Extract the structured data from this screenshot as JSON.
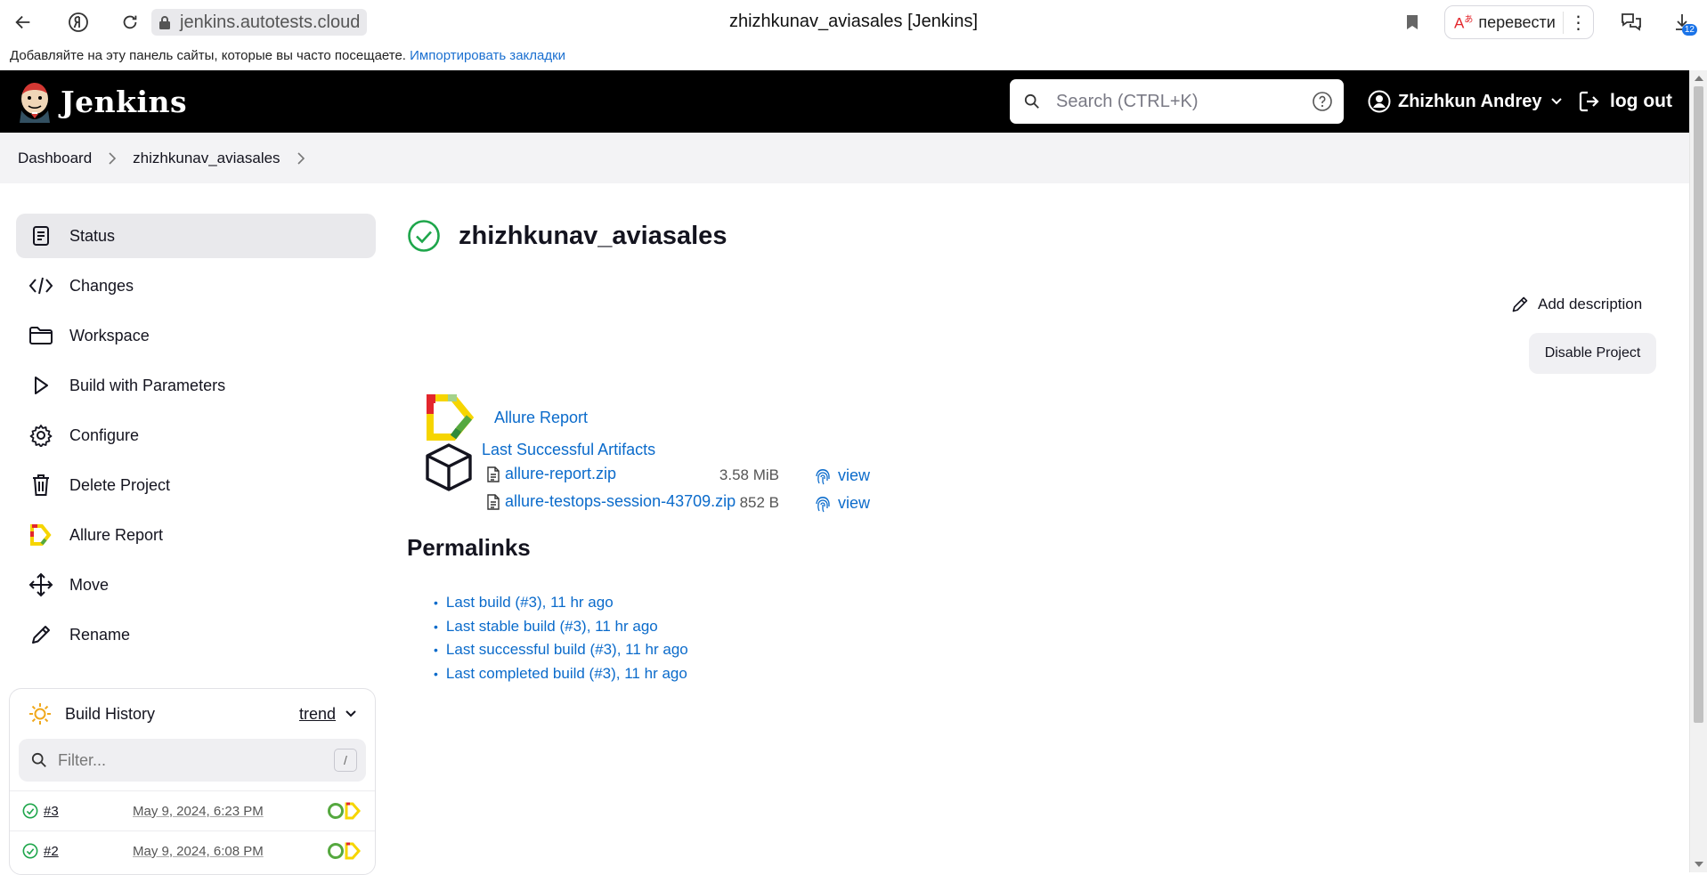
{
  "browser": {
    "address_host": "jenkins.autotests.cloud",
    "tab_title": "zhizhkunav_aviasales [Jenkins]",
    "translate_label": "перевести",
    "download_count": "12",
    "bookmarks_hint": "Добавляйте на эту панель сайты, которые вы часто посещаете.",
    "bookmarks_import": "Импортировать закладки"
  },
  "header": {
    "brand": "Jenkins",
    "search_placeholder": "Search (CTRL+K)",
    "user_name": "Zhizhkun Andrey",
    "logout_label": "log out"
  },
  "breadcrumb": {
    "items": [
      "Dashboard",
      "zhizhkunav_aviasales"
    ]
  },
  "sidebar": {
    "items": [
      {
        "label": "Status",
        "icon": "status-icon"
      },
      {
        "label": "Changes",
        "icon": "code-icon"
      },
      {
        "label": "Workspace",
        "icon": "folder-icon"
      },
      {
        "label": "Build with Parameters",
        "icon": "play-icon"
      },
      {
        "label": "Configure",
        "icon": "gear-icon"
      },
      {
        "label": "Delete Project",
        "icon": "trash-icon"
      },
      {
        "label": "Allure Report",
        "icon": "allure-icon"
      },
      {
        "label": "Move",
        "icon": "move-icon"
      },
      {
        "label": "Rename",
        "icon": "pencil-icon"
      }
    ]
  },
  "build_history": {
    "title": "Build History",
    "trend_label": "trend",
    "filter_placeholder": "Filter...",
    "filter_shortcut": "/",
    "builds": [
      {
        "number": "#3",
        "date": "May 9, 2024, 6:23 PM"
      },
      {
        "number": "#2",
        "date": "May 9, 2024, 6:08 PM"
      }
    ]
  },
  "main": {
    "title": "zhizhkunav_aviasales",
    "add_description_label": "Add description",
    "disable_project_label": "Disable Project",
    "allure_report_label": "Allure Report",
    "artifacts": {
      "title": "Last Successful Artifacts",
      "files": [
        {
          "name": "allure-report.zip",
          "size": "3.58 MiB",
          "view": "view"
        },
        {
          "name": "allure-testops-session-43709.zip",
          "size": "852 B",
          "view": "view"
        }
      ]
    },
    "permalinks_heading": "Permalinks",
    "permalinks": [
      "Last build (#3), 11 hr ago",
      "Last stable build (#3), 11 hr ago",
      "Last successful build (#3), 11 hr ago",
      "Last completed build (#3), 11 hr ago"
    ]
  },
  "colors": {
    "header_bg": "#000000",
    "link": "#0b6bcb",
    "success": "#1ea64b",
    "breadcrumb_bg": "#f3f3f5"
  }
}
